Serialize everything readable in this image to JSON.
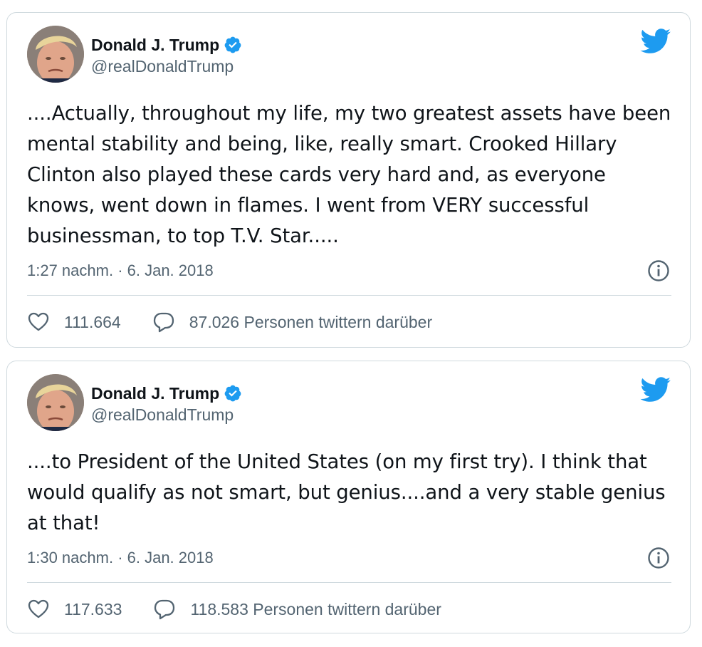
{
  "colors": {
    "text": "#0f1419",
    "muted": "#536471",
    "border": "#cfd9de",
    "twitter_blue": "#1d9bf0"
  },
  "tweets": [
    {
      "author": {
        "name": "Donald J. Trump",
        "handle": "@realDonaldTrump",
        "verified": true
      },
      "text": "....Actually, throughout my life, my two greatest assets have been mental stability and being, like, really smart. Crooked Hillary Clinton also played these cards very hard and, as everyone knows, went down in flames. I went from VERY successful businessman, to top T.V. Star.....",
      "timestamp": "1:27 nachm. · 6. Jan. 2018",
      "likes": "111.664",
      "replies_label": "87.026 Personen twittern darüber",
      "icons": {
        "brand": "twitter-bird-icon",
        "info": "info-icon",
        "like": "heart-icon",
        "reply": "speech-bubble-icon"
      }
    },
    {
      "author": {
        "name": "Donald J. Trump",
        "handle": "@realDonaldTrump",
        "verified": true
      },
      "text": "....to President of the United States (on my first try). I think that would qualify as not smart, but genius....and a very stable genius at that!",
      "timestamp": "1:30 nachm. · 6. Jan. 2018",
      "likes": "117.633",
      "replies_label": "118.583 Personen twittern darüber",
      "icons": {
        "brand": "twitter-bird-icon",
        "info": "info-icon",
        "like": "heart-icon",
        "reply": "speech-bubble-icon"
      }
    }
  ]
}
